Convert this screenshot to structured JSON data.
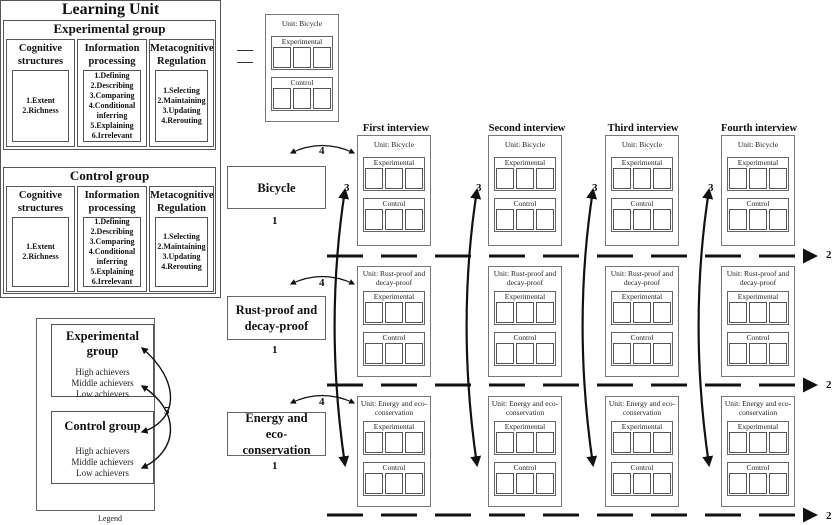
{
  "learning_unit": {
    "title": "Learning Unit",
    "groups": [
      {
        "title": "Experimental group",
        "columns": [
          {
            "title": "Cognitive structures",
            "items": [
              "1.Extent",
              "2.Richness"
            ]
          },
          {
            "title": "Information processing",
            "items": [
              "1.Defining",
              "2.Describing",
              "3.Comparing",
              "4.Conditional",
              "inferring",
              "5.Explaining",
              "6.Irrelevant"
            ]
          },
          {
            "title": "Metacognitive Regulation",
            "items": [
              "1.Selecting",
              "2.Maintaining",
              "3.Updating",
              "4.Rerouting"
            ]
          }
        ]
      },
      {
        "title": "Control group",
        "columns": [
          {
            "title": "Cognitive structures",
            "items": [
              "1.Extent",
              "2.Richness"
            ]
          },
          {
            "title": "Information processing",
            "items": [
              "1.Defining",
              "2.Describing",
              "3.Comparing",
              "4.Conditional",
              "inferring",
              "5.Explaining",
              "6.Irrelevant"
            ]
          },
          {
            "title": "Metacognitive Regulation",
            "items": [
              "1.Selecting",
              "2.Maintaining",
              "3.Updating",
              "4.Rerouting"
            ]
          }
        ]
      }
    ]
  },
  "equals_sign": "=",
  "example_card": {
    "title": "Unit: Bicycle",
    "experimental": "Experimental",
    "control": "Control"
  },
  "interviews": [
    "First interview",
    "Second interview",
    "Third interview",
    "Fourth interview"
  ],
  "topics": [
    {
      "label": "Bicycle",
      "card_title": "Unit: Bicycle"
    },
    {
      "label": "Rust-proof and decay-proof",
      "card_title": "Unit: Rust-proof and decay-proof"
    },
    {
      "label": "Energy and eco-conservation",
      "card_title": "Unit: Energy and eco-conservation"
    }
  ],
  "card_labels": {
    "experimental": "Experimental",
    "control": "Control"
  },
  "step_numbers": {
    "topic": "1",
    "timeline": "2",
    "interview_transition": "3",
    "unit_link": "4",
    "group_compare": "5"
  },
  "legend": {
    "caption": "Legend",
    "groups": [
      {
        "title": "Experimental group",
        "items": [
          "High achievers",
          "Middle achievers",
          "Low achievers"
        ]
      },
      {
        "title": "Control group",
        "items": [
          "High achievers",
          "Middle achievers",
          "Low achievers"
        ]
      }
    ]
  }
}
